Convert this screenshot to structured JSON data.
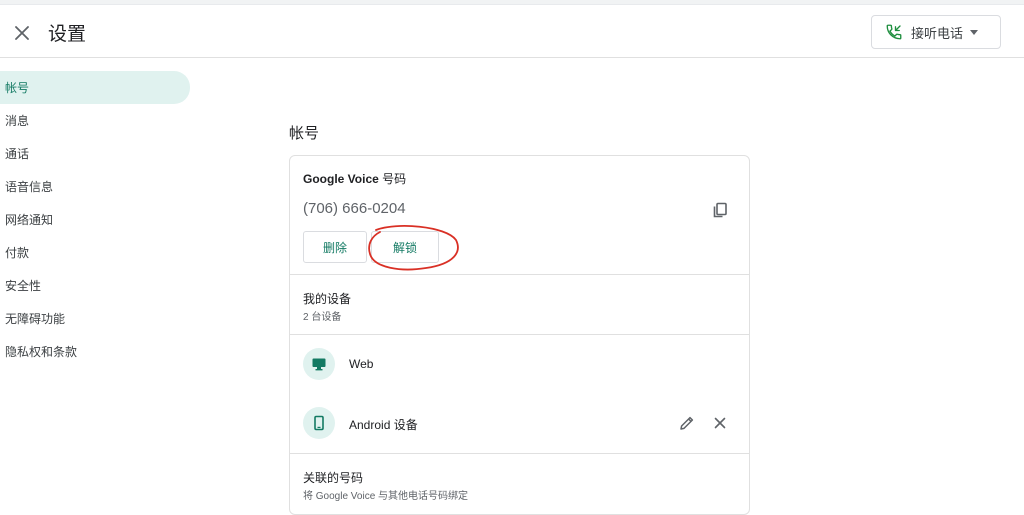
{
  "header": {
    "title": "设置",
    "call_button_label": "接听电话"
  },
  "sidebar": {
    "items": [
      {
        "label": "帐号"
      },
      {
        "label": "消息"
      },
      {
        "label": "通话"
      },
      {
        "label": "语音信息"
      },
      {
        "label": "网络通知"
      },
      {
        "label": "付款"
      },
      {
        "label": "安全性"
      },
      {
        "label": "无障碍功能"
      },
      {
        "label": "隐私权和条款"
      }
    ],
    "active_index": 0
  },
  "account": {
    "section_title": "帐号",
    "gv_label_bold": "Google Voice",
    "gv_label_rest": " 号码",
    "phone_number": "(706) 666-0204",
    "delete_label": "删除",
    "unlock_label": "解锁",
    "my_devices_title": "我的设备",
    "device_count": "2 台设备",
    "devices": [
      {
        "name": "Web",
        "icon": "monitor-icon"
      },
      {
        "name": "Android 设备",
        "icon": "phone-device-icon"
      }
    ],
    "linked_title": "关联的号码",
    "linked_subtitle": "将 Google Voice 与其他电话号码绑定"
  },
  "colors": {
    "accent": "#137a63",
    "active_bg": "#e0f2ef",
    "annotation": "#d93025"
  }
}
